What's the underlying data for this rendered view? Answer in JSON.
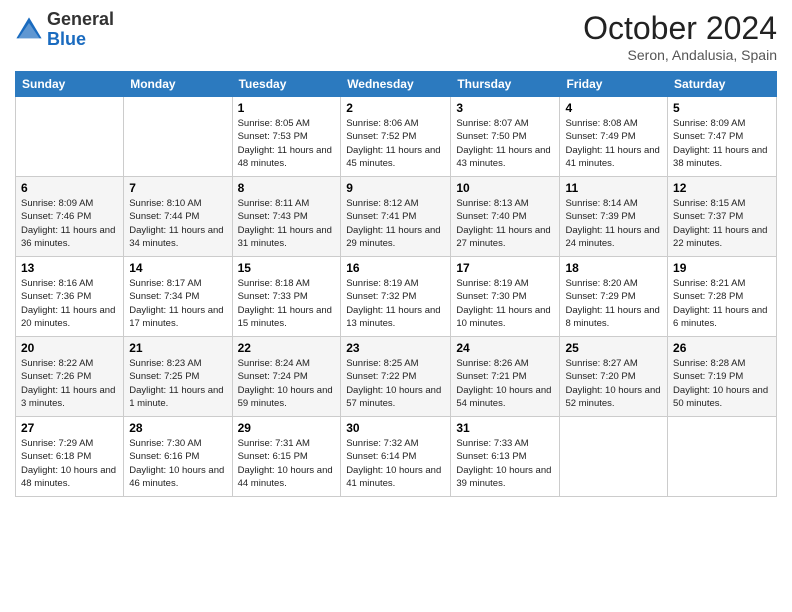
{
  "header": {
    "logo_general": "General",
    "logo_blue": "Blue",
    "month": "October 2024",
    "location": "Seron, Andalusia, Spain"
  },
  "days_of_week": [
    "Sunday",
    "Monday",
    "Tuesday",
    "Wednesday",
    "Thursday",
    "Friday",
    "Saturday"
  ],
  "weeks": [
    [
      null,
      null,
      {
        "day": "1",
        "sunrise": "Sunrise: 8:05 AM",
        "sunset": "Sunset: 7:53 PM",
        "daylight": "Daylight: 11 hours and 48 minutes."
      },
      {
        "day": "2",
        "sunrise": "Sunrise: 8:06 AM",
        "sunset": "Sunset: 7:52 PM",
        "daylight": "Daylight: 11 hours and 45 minutes."
      },
      {
        "day": "3",
        "sunrise": "Sunrise: 8:07 AM",
        "sunset": "Sunset: 7:50 PM",
        "daylight": "Daylight: 11 hours and 43 minutes."
      },
      {
        "day": "4",
        "sunrise": "Sunrise: 8:08 AM",
        "sunset": "Sunset: 7:49 PM",
        "daylight": "Daylight: 11 hours and 41 minutes."
      },
      {
        "day": "5",
        "sunrise": "Sunrise: 8:09 AM",
        "sunset": "Sunset: 7:47 PM",
        "daylight": "Daylight: 11 hours and 38 minutes."
      }
    ],
    [
      {
        "day": "6",
        "sunrise": "Sunrise: 8:09 AM",
        "sunset": "Sunset: 7:46 PM",
        "daylight": "Daylight: 11 hours and 36 minutes."
      },
      {
        "day": "7",
        "sunrise": "Sunrise: 8:10 AM",
        "sunset": "Sunset: 7:44 PM",
        "daylight": "Daylight: 11 hours and 34 minutes."
      },
      {
        "day": "8",
        "sunrise": "Sunrise: 8:11 AM",
        "sunset": "Sunset: 7:43 PM",
        "daylight": "Daylight: 11 hours and 31 minutes."
      },
      {
        "day": "9",
        "sunrise": "Sunrise: 8:12 AM",
        "sunset": "Sunset: 7:41 PM",
        "daylight": "Daylight: 11 hours and 29 minutes."
      },
      {
        "day": "10",
        "sunrise": "Sunrise: 8:13 AM",
        "sunset": "Sunset: 7:40 PM",
        "daylight": "Daylight: 11 hours and 27 minutes."
      },
      {
        "day": "11",
        "sunrise": "Sunrise: 8:14 AM",
        "sunset": "Sunset: 7:39 PM",
        "daylight": "Daylight: 11 hours and 24 minutes."
      },
      {
        "day": "12",
        "sunrise": "Sunrise: 8:15 AM",
        "sunset": "Sunset: 7:37 PM",
        "daylight": "Daylight: 11 hours and 22 minutes."
      }
    ],
    [
      {
        "day": "13",
        "sunrise": "Sunrise: 8:16 AM",
        "sunset": "Sunset: 7:36 PM",
        "daylight": "Daylight: 11 hours and 20 minutes."
      },
      {
        "day": "14",
        "sunrise": "Sunrise: 8:17 AM",
        "sunset": "Sunset: 7:34 PM",
        "daylight": "Daylight: 11 hours and 17 minutes."
      },
      {
        "day": "15",
        "sunrise": "Sunrise: 8:18 AM",
        "sunset": "Sunset: 7:33 PM",
        "daylight": "Daylight: 11 hours and 15 minutes."
      },
      {
        "day": "16",
        "sunrise": "Sunrise: 8:19 AM",
        "sunset": "Sunset: 7:32 PM",
        "daylight": "Daylight: 11 hours and 13 minutes."
      },
      {
        "day": "17",
        "sunrise": "Sunrise: 8:19 AM",
        "sunset": "Sunset: 7:30 PM",
        "daylight": "Daylight: 11 hours and 10 minutes."
      },
      {
        "day": "18",
        "sunrise": "Sunrise: 8:20 AM",
        "sunset": "Sunset: 7:29 PM",
        "daylight": "Daylight: 11 hours and 8 minutes."
      },
      {
        "day": "19",
        "sunrise": "Sunrise: 8:21 AM",
        "sunset": "Sunset: 7:28 PM",
        "daylight": "Daylight: 11 hours and 6 minutes."
      }
    ],
    [
      {
        "day": "20",
        "sunrise": "Sunrise: 8:22 AM",
        "sunset": "Sunset: 7:26 PM",
        "daylight": "Daylight: 11 hours and 3 minutes."
      },
      {
        "day": "21",
        "sunrise": "Sunrise: 8:23 AM",
        "sunset": "Sunset: 7:25 PM",
        "daylight": "Daylight: 11 hours and 1 minute."
      },
      {
        "day": "22",
        "sunrise": "Sunrise: 8:24 AM",
        "sunset": "Sunset: 7:24 PM",
        "daylight": "Daylight: 10 hours and 59 minutes."
      },
      {
        "day": "23",
        "sunrise": "Sunrise: 8:25 AM",
        "sunset": "Sunset: 7:22 PM",
        "daylight": "Daylight: 10 hours and 57 minutes."
      },
      {
        "day": "24",
        "sunrise": "Sunrise: 8:26 AM",
        "sunset": "Sunset: 7:21 PM",
        "daylight": "Daylight: 10 hours and 54 minutes."
      },
      {
        "day": "25",
        "sunrise": "Sunrise: 8:27 AM",
        "sunset": "Sunset: 7:20 PM",
        "daylight": "Daylight: 10 hours and 52 minutes."
      },
      {
        "day": "26",
        "sunrise": "Sunrise: 8:28 AM",
        "sunset": "Sunset: 7:19 PM",
        "daylight": "Daylight: 10 hours and 50 minutes."
      }
    ],
    [
      {
        "day": "27",
        "sunrise": "Sunrise: 7:29 AM",
        "sunset": "Sunset: 6:18 PM",
        "daylight": "Daylight: 10 hours and 48 minutes."
      },
      {
        "day": "28",
        "sunrise": "Sunrise: 7:30 AM",
        "sunset": "Sunset: 6:16 PM",
        "daylight": "Daylight: 10 hours and 46 minutes."
      },
      {
        "day": "29",
        "sunrise": "Sunrise: 7:31 AM",
        "sunset": "Sunset: 6:15 PM",
        "daylight": "Daylight: 10 hours and 44 minutes."
      },
      {
        "day": "30",
        "sunrise": "Sunrise: 7:32 AM",
        "sunset": "Sunset: 6:14 PM",
        "daylight": "Daylight: 10 hours and 41 minutes."
      },
      {
        "day": "31",
        "sunrise": "Sunrise: 7:33 AM",
        "sunset": "Sunset: 6:13 PM",
        "daylight": "Daylight: 10 hours and 39 minutes."
      },
      null,
      null
    ]
  ]
}
